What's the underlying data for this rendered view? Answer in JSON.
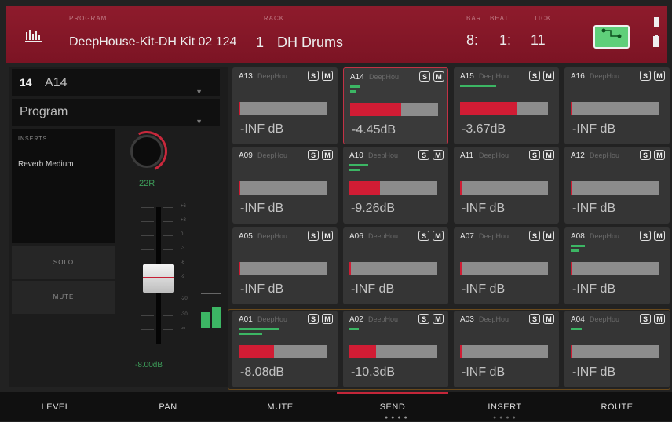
{
  "header": {
    "program_label": "Program",
    "program_value": "DeepHouse-Kit-DH Kit 02 124",
    "track_label": "Track",
    "track_number": "1",
    "track_name": "DH Drums",
    "bar_label": "Bar",
    "beat_label": "Beat",
    "tick_label": "Tick",
    "bar": "8:",
    "beat": "1:",
    "tick": "11"
  },
  "left_panel": {
    "pad_number": "14",
    "pad_name": "A14",
    "view_mode": "Program",
    "inserts_label": "INSERTS",
    "insert_effect": "Reverb Medium",
    "solo_label": "SOLO",
    "mute_label": "MUTE",
    "pan_value": "22R",
    "fader_level": "-8.00dB",
    "scale_marks": [
      "+6",
      "+3",
      "0",
      "-3",
      "-6",
      "-9",
      "-20",
      "-30",
      "-∞"
    ]
  },
  "pads": [
    {
      "name": "A13",
      "program": "DeepHou",
      "db": "-INF dB",
      "level": 0
    },
    {
      "name": "A14",
      "program": "DeepHou",
      "db": "-4.45dB",
      "level": 0.58
    },
    {
      "name": "A15",
      "program": "DeepHou",
      "db": "-3.67dB",
      "level": 0.65
    },
    {
      "name": "A16",
      "program": "DeepHou",
      "db": "-INF dB",
      "level": 0
    },
    {
      "name": "A09",
      "program": "DeepHou",
      "db": "-INF dB",
      "level": 0
    },
    {
      "name": "A10",
      "program": "DeepHou",
      "db": "-9.26dB",
      "level": 0.35
    },
    {
      "name": "A11",
      "program": "DeepHou",
      "db": "-INF dB",
      "level": 0
    },
    {
      "name": "A12",
      "program": "DeepHou",
      "db": "-INF dB",
      "level": 0
    },
    {
      "name": "A05",
      "program": "DeepHou",
      "db": "-INF dB",
      "level": 0
    },
    {
      "name": "A06",
      "program": "DeepHou",
      "db": "-INF dB",
      "level": 0
    },
    {
      "name": "A07",
      "program": "DeepHou",
      "db": "-INF dB",
      "level": 0
    },
    {
      "name": "A08",
      "program": "DeepHou",
      "db": "-INF dB",
      "level": 0
    },
    {
      "name": "A01",
      "program": "DeepHou",
      "db": "-8.08dB",
      "level": 0.4
    },
    {
      "name": "A02",
      "program": "DeepHou",
      "db": "-10.3dB",
      "level": 0.3
    },
    {
      "name": "A03",
      "program": "DeepHou",
      "db": "-INF dB",
      "level": 0
    },
    {
      "name": "A04",
      "program": "DeepHou",
      "db": "-INF dB",
      "level": 0
    }
  ],
  "pad_buttons": {
    "solo": "S",
    "mute": "M"
  },
  "tabs": [
    "LEVEL",
    "PAN",
    "MUTE",
    "SEND",
    "INSERT",
    "ROUTE"
  ],
  "active_tab": "SEND",
  "colors": {
    "header": "#8e1b2c",
    "accent": "#c8283c",
    "meter": "#d11c34",
    "wave": "#3cb664",
    "route": "#5fcf7a"
  },
  "icons": {
    "mixer": "mixer-icon",
    "route": "route-icon",
    "battery": "battery-icon"
  }
}
